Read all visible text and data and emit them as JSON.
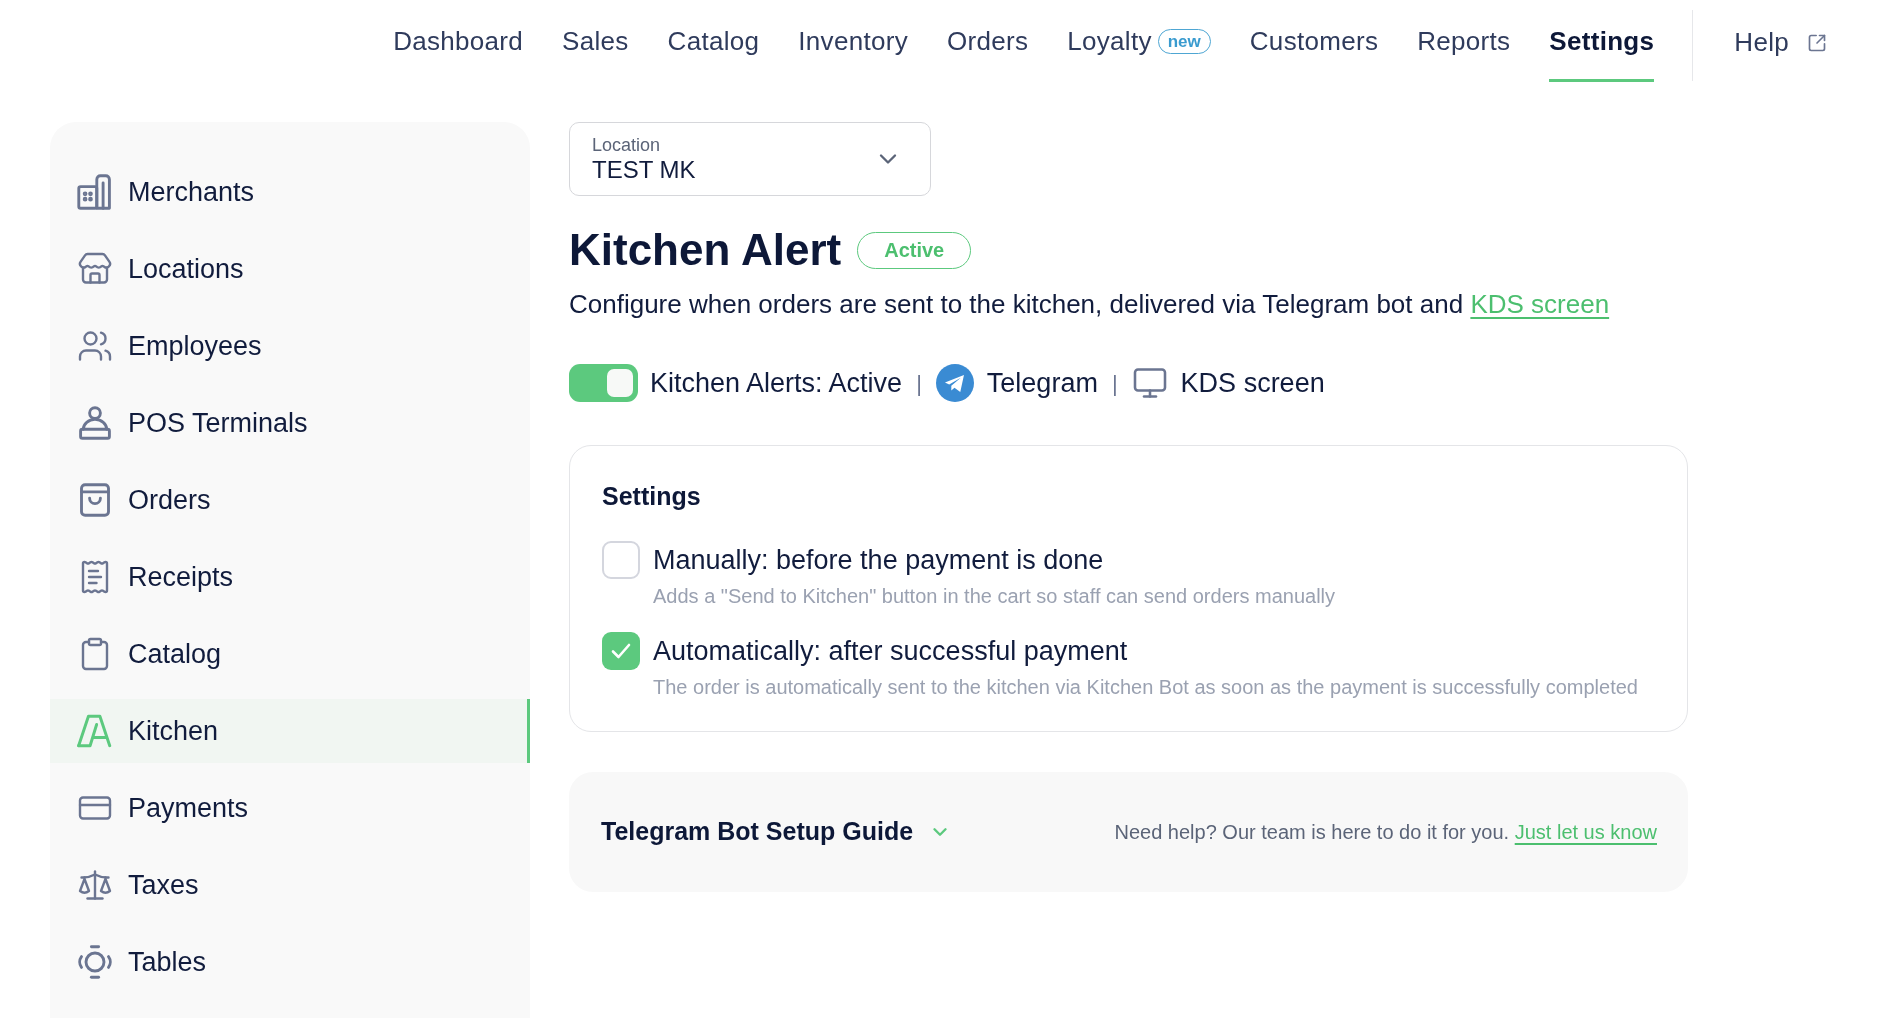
{
  "top_nav": {
    "items": [
      {
        "label": "Dashboard",
        "selected": false
      },
      {
        "label": "Sales",
        "selected": false
      },
      {
        "label": "Catalog",
        "selected": false
      },
      {
        "label": "Inventory",
        "selected": false
      },
      {
        "label": "Orders",
        "selected": false
      },
      {
        "label": "Loyalty",
        "selected": false,
        "badge": "new"
      },
      {
        "label": "Customers",
        "selected": false
      },
      {
        "label": "Reports",
        "selected": false
      },
      {
        "label": "Settings",
        "selected": true
      }
    ],
    "help": {
      "label": "Help"
    }
  },
  "sidebar": {
    "items": [
      {
        "label": "Merchants",
        "selected": false
      },
      {
        "label": "Locations",
        "selected": false
      },
      {
        "label": "Employees",
        "selected": false
      },
      {
        "label": "POS Terminals",
        "selected": false
      },
      {
        "label": "Orders",
        "selected": false
      },
      {
        "label": "Receipts",
        "selected": false
      },
      {
        "label": "Catalog",
        "selected": false
      },
      {
        "label": "Kitchen",
        "selected": true
      },
      {
        "label": "Payments",
        "selected": false
      },
      {
        "label": "Taxes",
        "selected": false
      },
      {
        "label": "Tables",
        "selected": false
      }
    ]
  },
  "location_select": {
    "label": "Location",
    "value": "TEST MK"
  },
  "page": {
    "title": "Kitchen Alert",
    "status_badge": "Active",
    "description": "Configure when orders are sent to the kitchen, delivered via Telegram bot and ",
    "description_link": "KDS screen"
  },
  "status_row": {
    "toggle": {
      "label": "Kitchen Alerts: Active",
      "on": true
    },
    "channels": [
      {
        "separator": "|",
        "label": "Telegram",
        "kind": "telegram"
      },
      {
        "separator": "|",
        "label": "KDS screen",
        "kind": "monitor"
      }
    ]
  },
  "settings_card": {
    "title": "Settings",
    "options": [
      {
        "label": "Manually: before the payment is done",
        "description": "Adds a \"Send to Kitchen\" button in the cart so staff can send orders manually",
        "checked": false
      },
      {
        "label": "Automatically: after successful payment",
        "description": "The order is automatically sent to the kitchen via Kitchen Bot as soon as the payment is successfully completed",
        "checked": true
      }
    ]
  },
  "guide": {
    "title": "Telegram Bot Setup Guide",
    "expanded": false,
    "help_text": "Need help? Our team is here to do it for you. ",
    "help_link": "Just let us know"
  }
}
